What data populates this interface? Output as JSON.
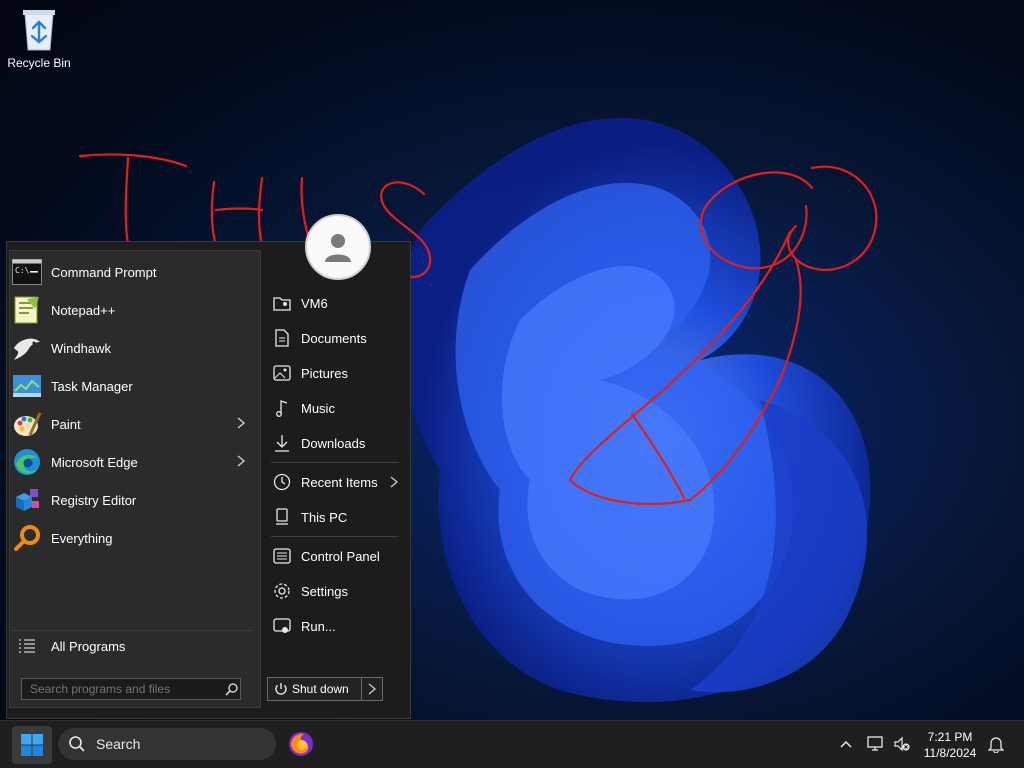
{
  "desktop": {
    "icons": [
      {
        "label": "Recycle Bin",
        "icon": "recycle-bin-icon"
      }
    ],
    "annotation": "THIS"
  },
  "start_menu": {
    "programs": [
      {
        "label": "Command Prompt",
        "icon": "command-prompt-icon",
        "has_submenu": false
      },
      {
        "label": "Notepad++",
        "icon": "notepad-plus-plus-icon",
        "has_submenu": false
      },
      {
        "label": "Windhawk",
        "icon": "windhawk-icon",
        "has_submenu": false
      },
      {
        "label": "Task Manager",
        "icon": "task-manager-icon",
        "has_submenu": false
      },
      {
        "label": "Paint",
        "icon": "paint-icon",
        "has_submenu": true
      },
      {
        "label": "Microsoft Edge",
        "icon": "edge-icon",
        "has_submenu": true
      },
      {
        "label": "Registry Editor",
        "icon": "registry-editor-icon",
        "has_submenu": false
      },
      {
        "label": "Everything",
        "icon": "everything-search-icon",
        "has_submenu": false
      }
    ],
    "all_programs": "All Programs",
    "search_placeholder": "Search programs and files",
    "places": [
      {
        "label": "VM6",
        "icon": "user-folder-icon"
      },
      {
        "label": "Documents",
        "icon": "documents-icon"
      },
      {
        "label": "Pictures",
        "icon": "pictures-icon"
      },
      {
        "label": "Music",
        "icon": "music-icon"
      },
      {
        "label": "Downloads",
        "icon": "downloads-icon"
      },
      {
        "label": "Recent Items",
        "icon": "recent-items-icon",
        "has_submenu": true
      },
      {
        "label": "This PC",
        "icon": "this-pc-icon"
      },
      {
        "label": "Control Panel",
        "icon": "control-panel-icon"
      },
      {
        "label": "Settings",
        "icon": "settings-gear-icon"
      },
      {
        "label": "Run...",
        "icon": "run-icon"
      }
    ],
    "shutdown_label": "Shut down"
  },
  "taskbar": {
    "search_label": "Search",
    "pinned": [
      {
        "icon": "firefox-icon"
      }
    ],
    "clock": {
      "time": "7:21 PM",
      "date": "11/8/2024"
    }
  },
  "colors": {
    "accent": "#0078d4",
    "annotation": "#e0201e",
    "menu_bg": "#1c1c1c",
    "pane_bg": "#2b2b2b"
  }
}
